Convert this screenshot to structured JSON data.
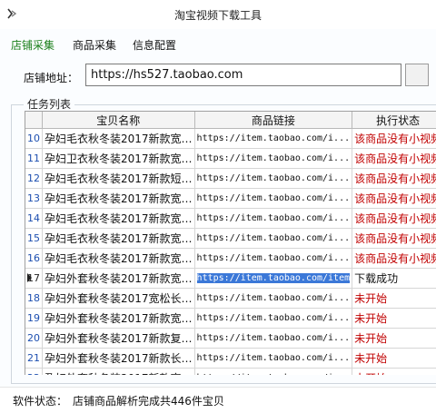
{
  "window": {
    "title": "淘宝视频下载工具"
  },
  "menu": [
    {
      "label": "店铺采集",
      "active": true
    },
    {
      "label": "商品采集",
      "active": false
    },
    {
      "label": "信息配置",
      "active": false
    }
  ],
  "address": {
    "label": "店铺地址：",
    "value": "https://hs527.taobao.com"
  },
  "task_list": {
    "label": "任务列表",
    "columns": [
      "",
      "宝贝名称",
      "商品链接",
      "执行状态"
    ],
    "rows": [
      {
        "idx": "10",
        "name": "孕妇毛衣秋冬装2017新款宽…",
        "link": "https://item.taobao.com/i...",
        "status": "该商品没有小视频"
      },
      {
        "idx": "11",
        "name": "孕妇卫衣秋冬装2017新款宽…",
        "link": "https://item.taobao.com/i...",
        "status": "该商品没有小视频"
      },
      {
        "idx": "12",
        "name": "孕妇毛衣秋冬装2017新款短…",
        "link": "https://item.taobao.com/i...",
        "status": "该商品没有小视频"
      },
      {
        "idx": "13",
        "name": "孕妇毛衣秋冬装2017新款宽…",
        "link": "https://item.taobao.com/i...",
        "status": "该商品没有小视频"
      },
      {
        "idx": "14",
        "name": "孕妇毛衣秋冬装2017新款宽…",
        "link": "https://item.taobao.com/i...",
        "status": "该商品没有小视频"
      },
      {
        "idx": "15",
        "name": "孕妇毛衣秋冬装2017新款宽…",
        "link": "https://item.taobao.com/i...",
        "status": "该商品没有小视频"
      },
      {
        "idx": "16",
        "name": "孕妇毛衣秋冬装2017新款宽…",
        "link": "https://item.taobao.com/i...",
        "status": "该商品没有小视频"
      },
      {
        "idx": "17",
        "name": "孕妇外套秋冬装2017新款宽…",
        "link": "https://item.taobao.com/item",
        "status": "下载成功",
        "selected": true
      },
      {
        "idx": "18",
        "name": "孕妇外套秋冬装2017宽松长…",
        "link": "https://item.taobao.com/i...",
        "status": "未开始"
      },
      {
        "idx": "19",
        "name": "孕妇外套秋冬装2017新款宽…",
        "link": "https://item.taobao.com/i...",
        "status": "未开始"
      },
      {
        "idx": "20",
        "name": "孕妇外套秋冬装2017新款复…",
        "link": "https://item.taobao.com/i...",
        "status": "未开始"
      },
      {
        "idx": "21",
        "name": "孕妇外套秋冬装2017新款长…",
        "link": "https://item.taobao.com/i...",
        "status": "未开始"
      },
      {
        "idx": "22",
        "name": "孕妇外套秋冬装2017新款宽…",
        "link": "https://item.taobao.com/i...",
        "status": "未开始"
      }
    ]
  },
  "status": {
    "label": "软件状态：",
    "text": "店铺商品解析完成共446件宝贝"
  },
  "colors": {
    "active_menu": "#1a7f1a",
    "status_red": "#c00000",
    "index_blue": "#1d4fb0",
    "selection": "#3b78d8"
  }
}
